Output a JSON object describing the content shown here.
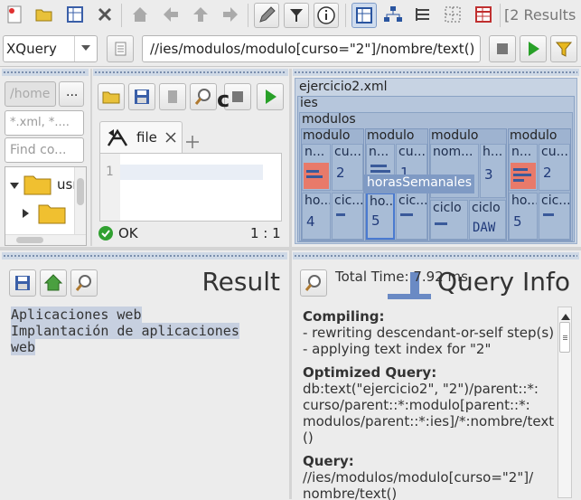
{
  "toolbar": {
    "results_label": "[2 Results",
    "icons": [
      "new-file-icon",
      "open-folder-icon",
      "grid-icon",
      "close-x-icon",
      "home-icon",
      "back-arrow-icon",
      "up-arrow-icon",
      "forward-arrow-icon",
      "edit-pencil-icon",
      "filter-icon",
      "info-icon",
      "table-view-icon",
      "tree-view-icon",
      "list-view-icon",
      "dot-grid-icon",
      "red-table-icon"
    ]
  },
  "query_bar": {
    "mode": "XQuery",
    "expression": "//ies/modulos/modulo[curso=\"2\"]/nombre/text()"
  },
  "project": {
    "path_placeholder": "/home",
    "browse_label": "...",
    "filter_placeholder": "*.xml, *....",
    "find_placeholder": "Find co...",
    "tree": [
      {
        "label": "usr"
      },
      {
        "label": ""
      }
    ]
  },
  "editor": {
    "title_fragment": "c",
    "tab_label": "file",
    "line_number": "1",
    "status": "OK",
    "position": "1 : 1"
  },
  "map": {
    "root": "ejercicio2.xml",
    "ies": "ies",
    "modulos": "modulos",
    "modulo": "modulo",
    "abbr_n": "n...",
    "abbr_cu": "cu...",
    "abbr_nom": "nom...",
    "abbr_h": "h...",
    "abbr_ho": "ho...",
    "abbr_cic": "cic...",
    "ciclo": "ciclo",
    "v2a": "2",
    "v1": "1",
    "v3": "3",
    "v2b": "2",
    "v4": "4",
    "v5a": "5",
    "v5b": "5",
    "daw": "DAW",
    "tooltip": "horasSemanales"
  },
  "result": {
    "title": "Result",
    "lines": [
      "Aplicaciones web",
      "Implantación de aplicaciones",
      "web"
    ]
  },
  "info": {
    "total_time": "Total Time: 7.92 ms",
    "title": "Query Info",
    "compiling_h": "Compiling:",
    "compiling_1": "- rewriting descendant-or-self step(s)",
    "compiling_2": "- applying text index for \"2\"",
    "optimized_h": "Optimized Query:",
    "optimized_1": "db:text(\"ejercicio2\", \"2\")/parent::*:",
    "optimized_2": "curso/parent::*:modulo[parent::*:",
    "optimized_3": "modulos/parent::*:ies]/*:nombre/text",
    "optimized_4": "()",
    "query_h": "Query:",
    "query_1": "//ies/modulos/modulo[curso=\"2\"]/",
    "query_2": "nombre/text()"
  }
}
